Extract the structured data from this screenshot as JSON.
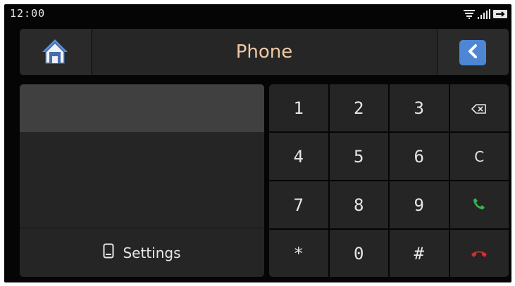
{
  "status_bar": {
    "time": "12:00",
    "icons": [
      "wifi-icon",
      "signal-icon",
      "usb-icon"
    ]
  },
  "header": {
    "title": "Phone",
    "home_icon": "home-icon",
    "back_icon": "chevron-left-icon"
  },
  "left_panel": {
    "number_display": "",
    "settings_label": "Settings",
    "settings_icon": "phone-device-icon"
  },
  "keypad": {
    "keys": [
      {
        "label": "1"
      },
      {
        "label": "2"
      },
      {
        "label": "3"
      },
      {
        "label": "",
        "icon": "backspace-icon"
      },
      {
        "label": "4"
      },
      {
        "label": "5"
      },
      {
        "label": "6"
      },
      {
        "label": "C"
      },
      {
        "label": "7"
      },
      {
        "label": "8"
      },
      {
        "label": "9"
      },
      {
        "label": "",
        "icon": "call-icon"
      },
      {
        "label": "*"
      },
      {
        "label": "0"
      },
      {
        "label": "#"
      },
      {
        "label": "",
        "icon": "hangup-icon"
      }
    ]
  },
  "colors": {
    "title": "#f0c9a4",
    "accent": "#4e86d6",
    "call": "#38b24a",
    "hangup": "#d0312d"
  }
}
